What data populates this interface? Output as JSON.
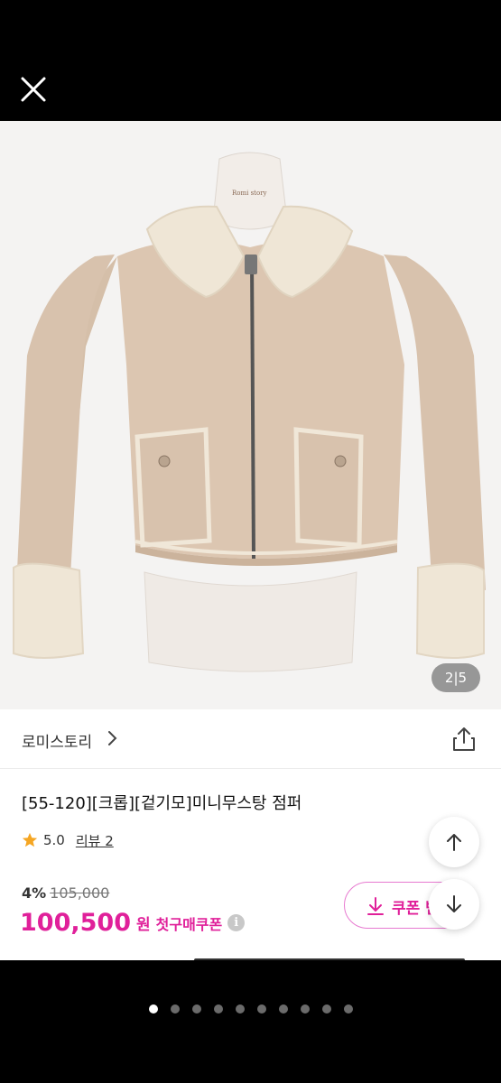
{
  "viewer": {
    "close_icon": "close-icon",
    "page_dots": {
      "count": 10,
      "active_index": 0
    }
  },
  "product": {
    "image_counter": "2|5",
    "image_counter_parts": {
      "current": "2",
      "sep": "|",
      "total": "5"
    },
    "mannequin_label": "Romi story",
    "brand": "로미스토리",
    "title": "[55-120][크롭][겉기모]미니무스탕 점퍼",
    "rating": "5.0",
    "review_link": "리뷰 2",
    "discount_percent": "4%",
    "original_price": "105,000",
    "price": "100,500",
    "currency": "원",
    "coupon_label": "첫구매쿠폰",
    "coupon_button": "쿠폰 받",
    "colors": {
      "accent": "#e0209a",
      "star": "#f5a623",
      "jacket": "#d8c2ad",
      "shearling": "#efe6d6"
    }
  }
}
